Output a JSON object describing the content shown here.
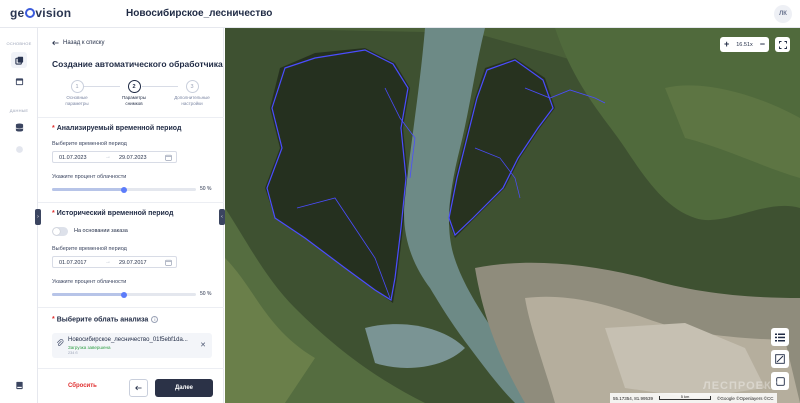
{
  "header": {
    "logo": "geovision",
    "project_title": "Новосибирское_лесничество",
    "user_initials": "ЛК"
  },
  "rail": {
    "section_main": "ОСНОВНОЕ",
    "section_data": "ДАННЫЕ",
    "icons": [
      "layers-icon",
      "calendar-icon",
      "database-icon",
      "globe-icon",
      "library-icon"
    ]
  },
  "panel": {
    "back_label": "Назад к списку",
    "title": "Создание автоматического обработчика",
    "steps": [
      {
        "number": "1",
        "label_line1": "Основные",
        "label_line2": "параметры"
      },
      {
        "number": "2",
        "label_line1": "Параметры",
        "label_line2": "снимков"
      },
      {
        "number": "3",
        "label_line1": "Дополнительные",
        "label_line2": "настройки"
      }
    ],
    "current_step": 2,
    "analyzed": {
      "heading": "Анализируемый временной период",
      "period_label": "Выберите временной период",
      "date_from": "01.07.2023",
      "date_to": "29.07.2023",
      "cloud_label": "Укажите процент облачности",
      "cloud_value": 50,
      "cloud_text": "50 %"
    },
    "historical": {
      "heading": "Исторический временной период",
      "toggle_label": "На основании заказа",
      "toggle_on": false,
      "period_label": "Выберите временной период",
      "date_from": "01.07.2017",
      "date_to": "29.07.2017",
      "cloud_label": "Укажите процент облачности",
      "cloud_value": 50,
      "cloud_text": "50 %"
    },
    "area": {
      "heading": "Выберите облать анализа",
      "file_name": "Новосибирское_лесничество_01f5ebf1da...",
      "file_status": "Загрузка завершена",
      "file_size": "234 б"
    },
    "buttons": {
      "reset": "Сбросить",
      "next": "Далее"
    }
  },
  "map": {
    "zoom": "16.51x",
    "coordinates": "55.17354, 81.99539",
    "scale": "5 km",
    "attribution": "©Google ©Openlayers ©CC",
    "watermark": "ЛЕСПРОЕКТ",
    "colors": {
      "boundary": "#4b4dff",
      "forest": "#2d3a27",
      "river": "#6e8b8a",
      "urban": "#b9b3a6"
    }
  }
}
